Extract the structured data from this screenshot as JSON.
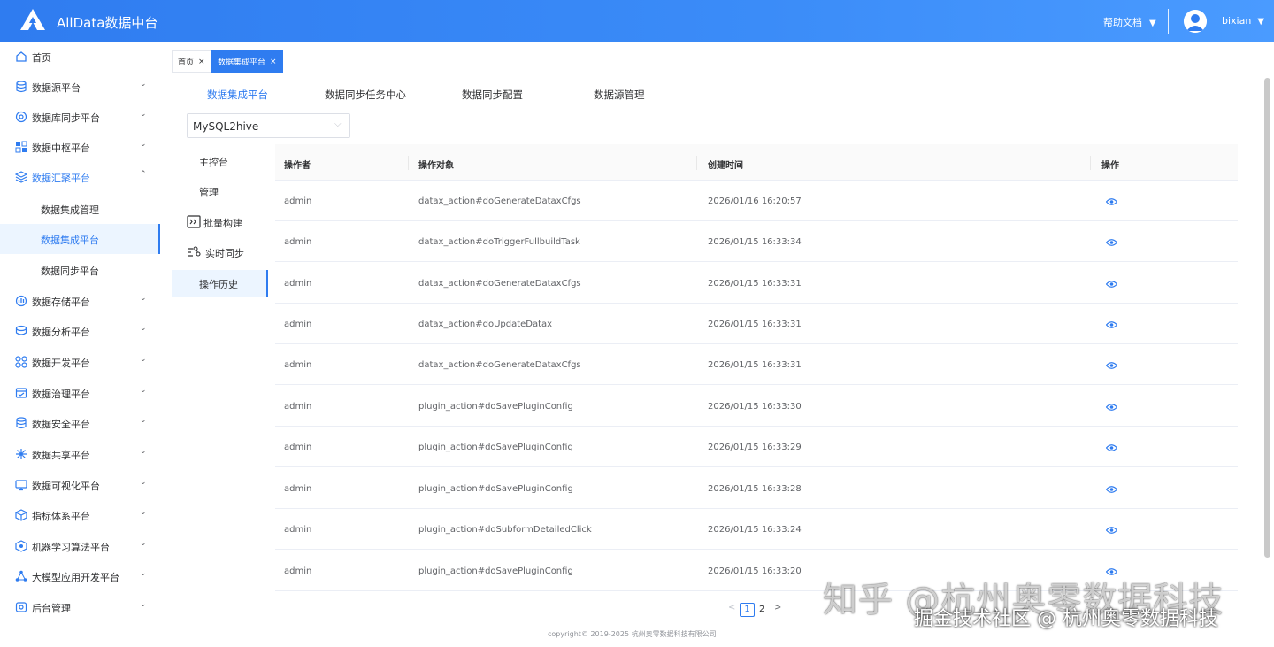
{
  "header": {
    "app_title": "AllData数据中台",
    "help_label": "帮助文档",
    "username": "bixian"
  },
  "sidebar": {
    "items": [
      {
        "label": "首页",
        "icon": "home-icon"
      },
      {
        "label": "数据源平台",
        "icon": "database-icon"
      },
      {
        "label": "数据库同步平台",
        "icon": "sync-icon"
      },
      {
        "label": "数据中枢平台",
        "icon": "hub-icon"
      },
      {
        "label": "数据汇聚平台",
        "icon": "layers-icon",
        "expanded": true
      },
      {
        "label": "数据集成管理",
        "sub": true
      },
      {
        "label": "数据集成平台",
        "sub": true,
        "active": true
      },
      {
        "label": "数据同步平台",
        "sub": true
      },
      {
        "label": "数据存储平台",
        "icon": "storage-icon"
      },
      {
        "label": "数据分析平台",
        "icon": "analysis-icon"
      },
      {
        "label": "数据开发平台",
        "icon": "grid-icon"
      },
      {
        "label": "数据治理平台",
        "icon": "governance-icon"
      },
      {
        "label": "数据安全平台",
        "icon": "security-icon"
      },
      {
        "label": "数据共享平台",
        "icon": "share-icon"
      },
      {
        "label": "数据可视化平台",
        "icon": "monitor-icon"
      },
      {
        "label": "指标体系平台",
        "icon": "cube-icon"
      },
      {
        "label": "机器学习算法平台",
        "icon": "ml-icon"
      },
      {
        "label": "大模型应用开发平台",
        "icon": "network-icon"
      },
      {
        "label": "后台管理",
        "icon": "admin-icon"
      }
    ]
  },
  "tags": [
    {
      "label": "首页"
    },
    {
      "label": "数据集成平台",
      "active": true
    }
  ],
  "top_tabs": [
    {
      "label": "数据集成平台",
      "active": true
    },
    {
      "label": "数据同步任务中心"
    },
    {
      "label": "数据同步配置"
    },
    {
      "label": "数据源管理"
    }
  ],
  "select": {
    "value": "MySQL2hive"
  },
  "left_nav": [
    {
      "label": "主控台"
    },
    {
      "label": "管理"
    },
    {
      "label": "批量构建",
      "icon": "batch-build-icon"
    },
    {
      "label": "实时同步",
      "icon": "realtime-sync-icon"
    },
    {
      "label": "操作历史",
      "active": true
    }
  ],
  "table": {
    "columns": [
      "操作者",
      "操作对象",
      "创建时间",
      "操作"
    ],
    "rows": [
      [
        "admin",
        "datax_action#doGenerateDataxCfgs",
        "2026/01/16 16:20:57"
      ],
      [
        "admin",
        "datax_action#doTriggerFullbuildTask",
        "2026/01/15 16:33:34"
      ],
      [
        "admin",
        "datax_action#doGenerateDataxCfgs",
        "2026/01/15 16:33:31"
      ],
      [
        "admin",
        "datax_action#doUpdateDatax",
        "2026/01/15 16:33:31"
      ],
      [
        "admin",
        "datax_action#doGenerateDataxCfgs",
        "2026/01/15 16:33:31"
      ],
      [
        "admin",
        "plugin_action#doSavePluginConfig",
        "2026/01/15 16:33:30"
      ],
      [
        "admin",
        "plugin_action#doSavePluginConfig",
        "2026/01/15 16:33:29"
      ],
      [
        "admin",
        "plugin_action#doSavePluginConfig",
        "2026/01/15 16:33:28"
      ],
      [
        "admin",
        "plugin_action#doSubformDetailedClick",
        "2026/01/15 16:33:24"
      ],
      [
        "admin",
        "plugin_action#doSavePluginConfig",
        "2026/01/15 16:33:20"
      ]
    ]
  },
  "pagination": {
    "pages": [
      "1",
      "2"
    ],
    "current": "1"
  },
  "footer": {
    "copyright": "copyright© 2019-2025 杭州奥零数据科技有限公司"
  },
  "watermark": {
    "line1": "知乎 @杭州奥零数据科技",
    "line2": "掘金技术社区 @ 杭州奥零数据科技"
  },
  "colors": {
    "primary": "#2f7cf0",
    "active_bg": "#ecf5ff"
  }
}
